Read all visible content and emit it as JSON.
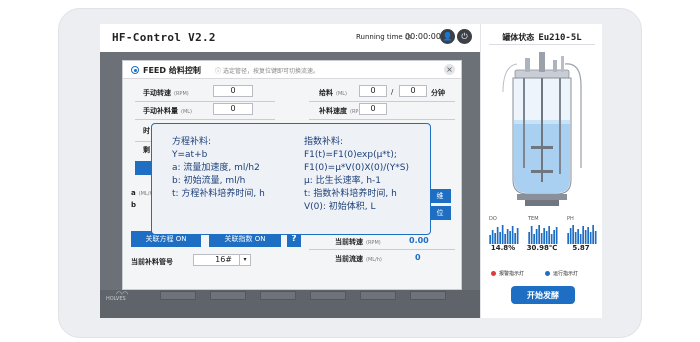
{
  "app": {
    "title": "HF-Control V2.2",
    "running_label": "Running time",
    "running_time": "00:00:00"
  },
  "feed_panel": {
    "title": "FEED 给料控制",
    "hint": "选定管径，按复位键即可切换流速。",
    "rows_left": [
      {
        "label": "手动转速",
        "unit": "(RPM)",
        "value": "0"
      },
      {
        "label": "手动补料量",
        "unit": "(ML)",
        "value": "0"
      },
      {
        "label": "时",
        "unit": "",
        "value": ""
      },
      {
        "label": "剩",
        "unit": "",
        "value": ""
      }
    ],
    "rows_right": [
      {
        "label": "给料",
        "unit": "(ML)",
        "value": "0",
        "value2": "0",
        "suffix": "分钟"
      },
      {
        "label": "补料速度",
        "unit": "(RPM)",
        "value": "0"
      }
    ],
    "var_a": "a",
    "var_a_unit": "(ML/h)",
    "var_b": "b",
    "side_btn_1": "维",
    "side_btn_2": "位",
    "link_eq_button": "关联方程 ON",
    "link_exp_button": "关联指数 ON",
    "help_button": "?",
    "current_speed_label": "当前转速",
    "current_speed_unit": "(RPM)",
    "current_speed_value": "0.00",
    "current_flow_label": "当前流速",
    "current_flow_unit": "(ML/h)",
    "current_flow_value": "0",
    "tube_label": "当前补料管号",
    "tube_value": "16#",
    "tube_dropdown": "▾",
    "brand": "HOLVES"
  },
  "tooltip": {
    "equation": [
      "方程补料:",
      "Y=at+b",
      "a: 流量加速度, ml/h2",
      "b: 初始流量, ml/h",
      "t: 方程补料培养时间, h"
    ],
    "exponential": [
      "指数补料:",
      "F1(t)=F1(0)exp(μ*t);",
      "F1(0)=μ*V(0)X(0)/(Y*S)",
      "μ: 比生长速率, h-1",
      "t: 指数补料培养时间, h",
      "V(0): 初始体积, L"
    ]
  },
  "tank": {
    "status_label": "罐体状态",
    "model": "Eu210-5L",
    "metrics": [
      {
        "label": "DO",
        "value": "14.8%",
        "bars": [
          0.45,
          0.7,
          0.55,
          0.85,
          0.6,
          0.95,
          0.5,
          0.75,
          0.65,
          0.9,
          0.55,
          0.8
        ]
      },
      {
        "label": "TEM",
        "value": "30.98℃",
        "bars": [
          0.6,
          0.9,
          0.5,
          0.75,
          0.95,
          0.55,
          0.8,
          0.65,
          0.9,
          0.5,
          0.7,
          0.85
        ]
      },
      {
        "label": "PH",
        "value": "5.87",
        "bars": [
          0.55,
          0.8,
          0.95,
          0.6,
          0.75,
          0.5,
          0.9,
          0.7,
          0.85,
          0.6,
          0.95,
          0.65
        ]
      }
    ],
    "alarm_label": "报警指示灯",
    "run_label": "运行指示灯",
    "alarm_color": "#e03a3a",
    "run_color": "#1e6fc4",
    "start_button": "开始发酵"
  }
}
